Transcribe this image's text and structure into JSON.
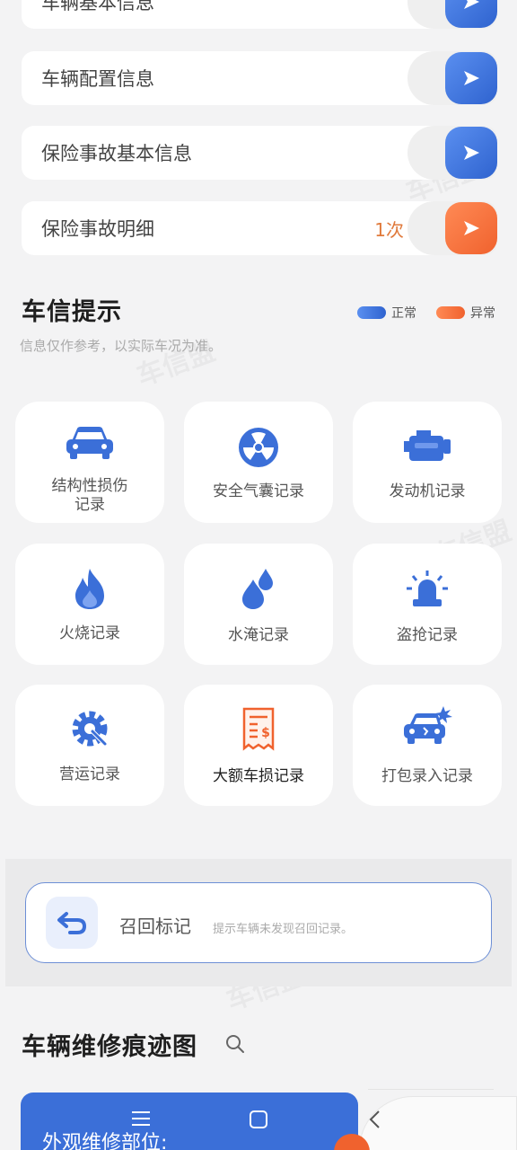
{
  "info_rows": [
    {
      "label": "车辆基本信息",
      "count": "",
      "accent": "blue"
    },
    {
      "label": "车辆配置信息",
      "count": "",
      "accent": "blue"
    },
    {
      "label": "保险事故基本信息",
      "count": "",
      "accent": "blue"
    },
    {
      "label": "保险事故明细",
      "count": "1次",
      "accent": "orange"
    }
  ],
  "tips": {
    "title": "车信提示",
    "subtitle": "信息仅作参考，以实际车况为准。",
    "legend": {
      "normal": "正常",
      "abnormal": "异常"
    }
  },
  "records": [
    {
      "label": "结构性损伤记录",
      "icon": "car-icon",
      "status": "normal"
    },
    {
      "label": "安全气囊记录",
      "icon": "airbag-icon",
      "status": "normal"
    },
    {
      "label": "发动机记录",
      "icon": "engine-icon",
      "status": "normal"
    },
    {
      "label": "火烧记录",
      "icon": "fire-icon",
      "status": "normal"
    },
    {
      "label": "水淹记录",
      "icon": "water-drop-icon",
      "status": "normal"
    },
    {
      "label": "盗抢记录",
      "icon": "alarm-light-icon",
      "status": "normal"
    },
    {
      "label": "营运记录",
      "icon": "gear-wrench-icon",
      "status": "normal"
    },
    {
      "label": "大额车损记录",
      "icon": "receipt-icon",
      "status": "abnormal"
    },
    {
      "label": "打包录入记录",
      "icon": "crashed-car-icon",
      "status": "normal"
    }
  ],
  "recall": {
    "title": "召回标记",
    "note": "提示车辆未发现召回记录。"
  },
  "repair": {
    "title": "车辆维修痕迹图",
    "panel_label": "外观维修部位:"
  },
  "colors": {
    "blue": "#3b6fd8",
    "orange": "#f0622e",
    "background": "#f3f3f4"
  },
  "watermark": "车信盟"
}
